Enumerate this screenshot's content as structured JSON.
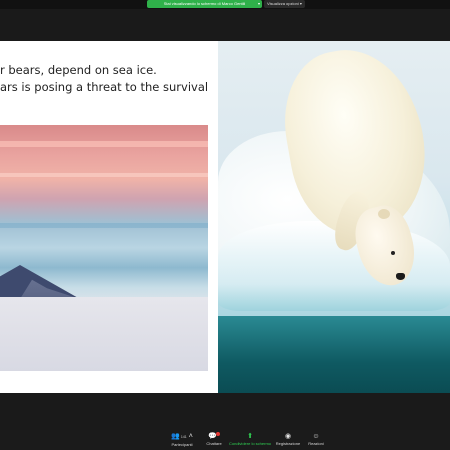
{
  "share_banner": {
    "label": "Stai visualizzando lo schermo di Marco Gentili",
    "view_options": "Visualizza opzioni"
  },
  "slide": {
    "line1": "r bears, depend on sea ice.",
    "line2": "ars is posing a threat to the survival"
  },
  "toolbar": {
    "participants_count": "141",
    "items": [
      {
        "label": "Partecipanti",
        "icon": "participants-icon"
      },
      {
        "label": "Chattare",
        "icon": "chat-icon"
      },
      {
        "label": "Condividere lo schermo",
        "icon": "share-screen-icon"
      },
      {
        "label": "Registrazione",
        "icon": "record-icon"
      },
      {
        "label": "Reazioni",
        "icon": "reactions-icon"
      }
    ]
  },
  "colors": {
    "accent_green": "#2fb14a",
    "toolbar_bg": "#1b1b1b"
  }
}
